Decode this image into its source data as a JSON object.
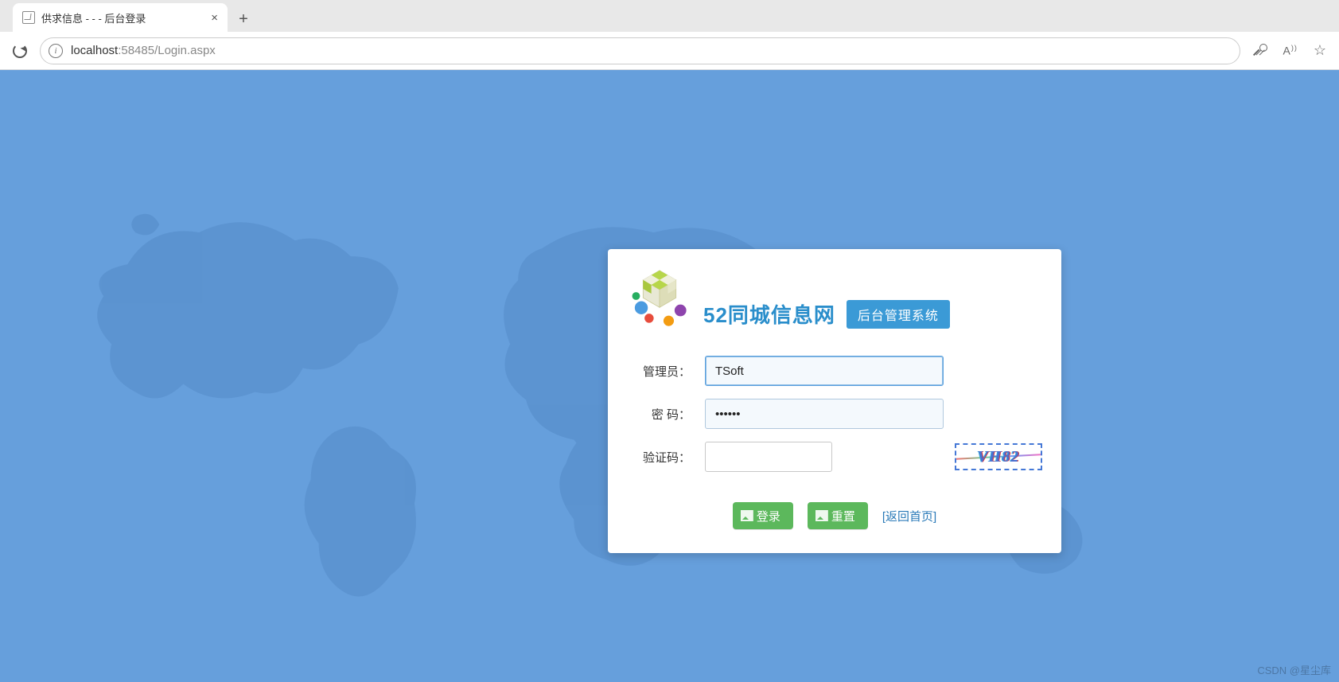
{
  "browser": {
    "tab_title": "供求信息 - - - 后台登录",
    "url_host": "localhost",
    "url_port_path": ":58485/Login.aspx"
  },
  "login": {
    "site_title": "52同城信息网",
    "subtitle": "后台管理系统",
    "labels": {
      "admin": "管理员：",
      "password": "密  码：",
      "captcha": "验证码："
    },
    "values": {
      "admin": "TSoft",
      "password": "••••••",
      "captcha": ""
    },
    "captcha_text": "VH82",
    "buttons": {
      "login": "登录",
      "reset": "重置"
    },
    "home_link": "[返回首页]"
  },
  "watermark": "CSDN @星尘库"
}
